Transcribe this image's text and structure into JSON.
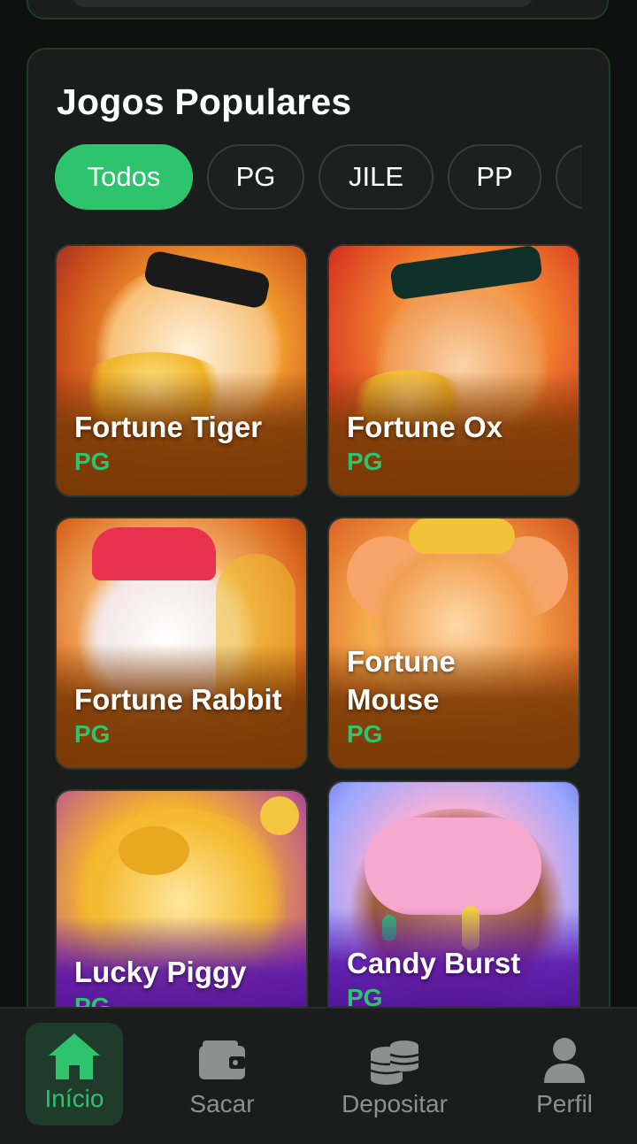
{
  "section": {
    "title": "Jogos Populares"
  },
  "filters": [
    {
      "label": "Todos",
      "active": true
    },
    {
      "label": "PG",
      "active": false
    },
    {
      "label": "JILE",
      "active": false
    },
    {
      "label": "PP",
      "active": false
    }
  ],
  "games": [
    {
      "name": "Fortune Tiger",
      "provider": "PG",
      "art": "tiger"
    },
    {
      "name": "Fortune Ox",
      "provider": "PG",
      "art": "ox"
    },
    {
      "name": "Fortune Rabbit",
      "provider": "PG",
      "art": "rabbit"
    },
    {
      "name": "Fortune Mouse",
      "provider": "PG",
      "art": "mouse"
    },
    {
      "name": "Lucky Piggy",
      "provider": "PG",
      "art": "piggy"
    },
    {
      "name": "Candy Burst",
      "provider": "PG",
      "art": "candy"
    }
  ],
  "nav": [
    {
      "label": "Início",
      "icon": "home-icon",
      "active": true
    },
    {
      "label": "Sacar",
      "icon": "wallet-icon",
      "active": false
    },
    {
      "label": "Depositar",
      "icon": "coins-icon",
      "active": false
    },
    {
      "label": "Perfil",
      "icon": "user-icon",
      "active": false
    }
  ],
  "colors": {
    "accent": "#2ec46d",
    "background": "#0f1010",
    "panel": "#1b1c1c"
  }
}
